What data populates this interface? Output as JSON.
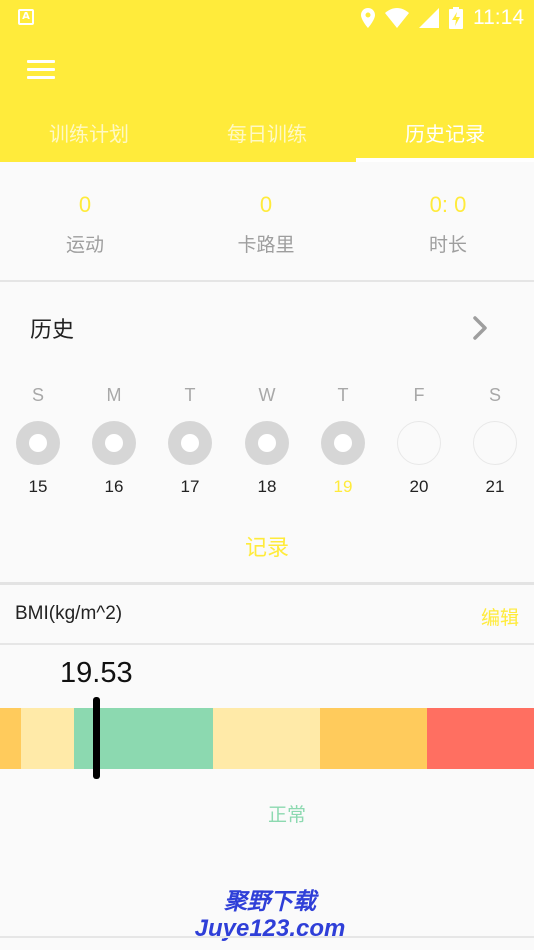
{
  "status_bar": {
    "time": "11:14",
    "notification_icon": "a-icon",
    "icons": [
      "location-icon",
      "wifi-icon",
      "signal-icon",
      "battery-icon"
    ]
  },
  "colors": {
    "primary": "#ffeb3b",
    "text": "#222222",
    "muted": "#9e9e9e"
  },
  "tabs": [
    {
      "label": "训练计划",
      "active": false
    },
    {
      "label": "每日训练",
      "active": false
    },
    {
      "label": "历史记录",
      "active": true
    }
  ],
  "stats": [
    {
      "value": "0",
      "label": "运动"
    },
    {
      "value": "0",
      "label": "卡路里"
    },
    {
      "value": "0: 0",
      "label": "时长"
    }
  ],
  "history": {
    "title": "历史",
    "days": [
      {
        "letter": "S",
        "date": "15",
        "done": true,
        "today": false
      },
      {
        "letter": "M",
        "date": "16",
        "done": true,
        "today": false
      },
      {
        "letter": "T",
        "date": "17",
        "done": true,
        "today": false
      },
      {
        "letter": "W",
        "date": "18",
        "done": true,
        "today": false
      },
      {
        "letter": "T",
        "date": "19",
        "done": true,
        "today": true
      },
      {
        "letter": "F",
        "date": "20",
        "done": false,
        "today": false
      },
      {
        "letter": "S",
        "date": "21",
        "done": false,
        "today": false
      }
    ],
    "record_label": "记录"
  },
  "bmi": {
    "label": "BMI(kg/m^2)",
    "edit_label": "编辑",
    "value": "19.53",
    "status": "正常",
    "scale_colors": [
      "#ffcb5c",
      "#ffeaa8",
      "#8cd9b0",
      "#ffeaa8",
      "#ffcb5c",
      "#ff6f61"
    ]
  },
  "watermark": {
    "line1": "聚野下载",
    "line2": "Juye123.com"
  }
}
